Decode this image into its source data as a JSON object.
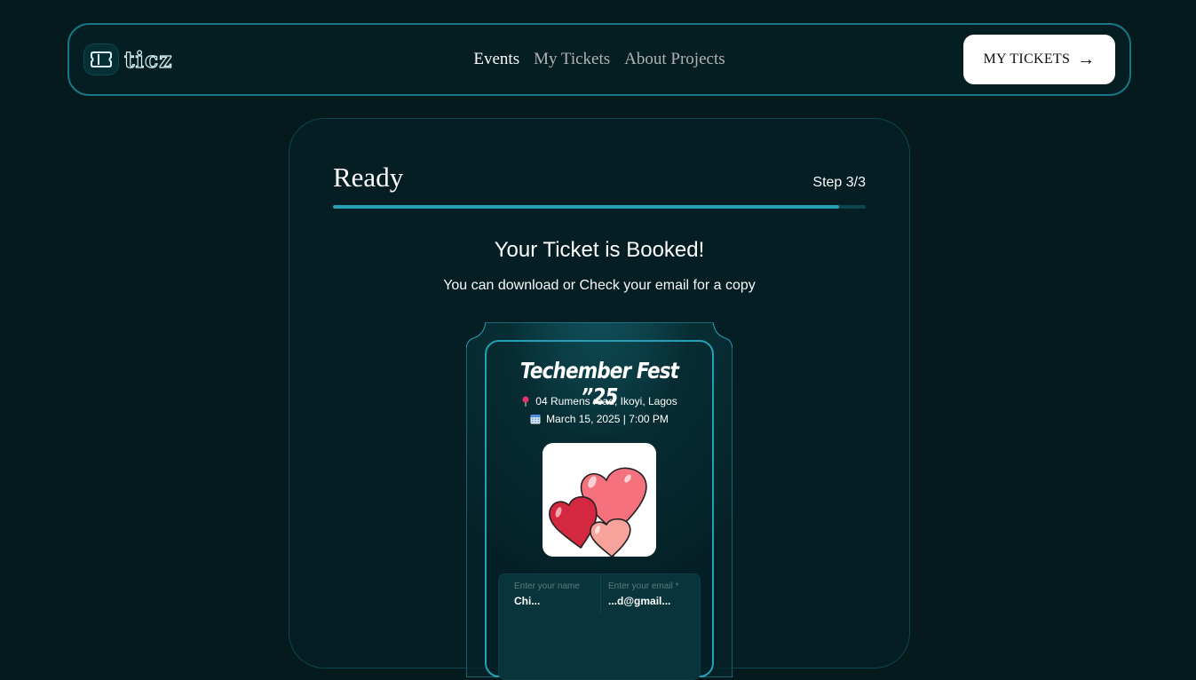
{
  "header": {
    "logo_text": "ticz",
    "nav": [
      {
        "label": "Events"
      },
      {
        "label": "My Tickets"
      },
      {
        "label": "About Projects"
      }
    ],
    "cta_label": "MY TICKETS",
    "cta_arrow": "→"
  },
  "step": {
    "title": "Ready",
    "count": "Step 3/3",
    "progress": 0.95
  },
  "confirmation": {
    "title": "Your Ticket is Booked!",
    "subtitle": "You can download or Check your email for a copy"
  },
  "ticket": {
    "event_title": "Techember Fest ”25",
    "location": "04 Rumens road, Ikoyi, Lagos",
    "datetime": "March 15, 2025 | 7:00 PM",
    "name_label": "Enter your name",
    "name_value": "Chi...",
    "email_label": "Enter your email *",
    "email_value": "...d@gmail..."
  },
  "colors": {
    "background": "#041a1c",
    "accent": "#24a0b5",
    "border": "#197686"
  }
}
